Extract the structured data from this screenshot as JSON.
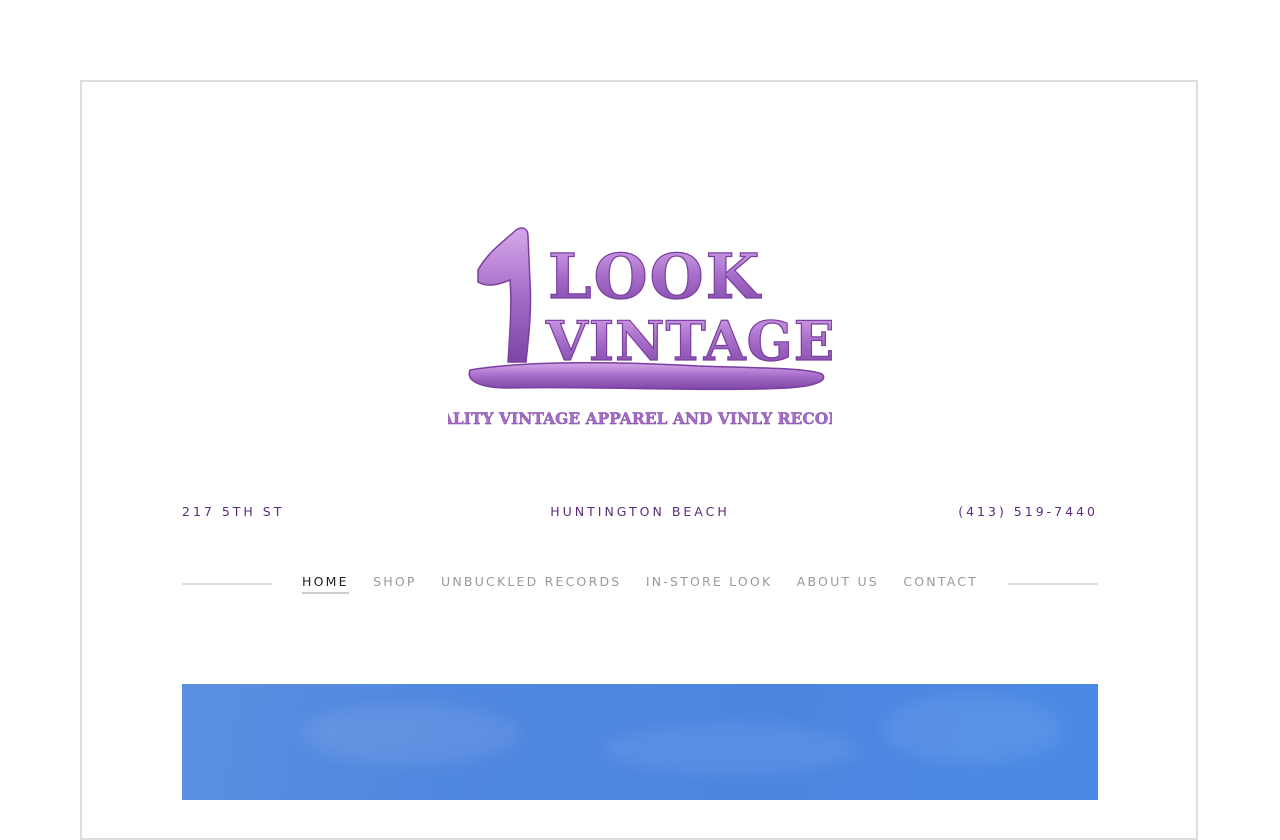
{
  "logo": {
    "line1": "1 LOOK",
    "line2": "VINTAGE",
    "tagline": "QUALITY VINTAGE APPAREL AND VINLY RECORDS",
    "color": "#a56cc8"
  },
  "info": {
    "address": "217 5TH ST",
    "city": "HUNTINGTON BEACH",
    "phone": "(413) 519-7440",
    "color": "#5a2c7a"
  },
  "nav": {
    "items": [
      {
        "label": "HOME",
        "active": true
      },
      {
        "label": "SHOP",
        "active": false
      },
      {
        "label": "UNBUCKLED RECORDS",
        "active": false
      },
      {
        "label": "IN-STORE LOOK",
        "active": false
      },
      {
        "label": "ABOUT US",
        "active": false
      },
      {
        "label": "CONTACT",
        "active": false
      }
    ]
  },
  "hero": {
    "sky_color": "#4f86df"
  }
}
